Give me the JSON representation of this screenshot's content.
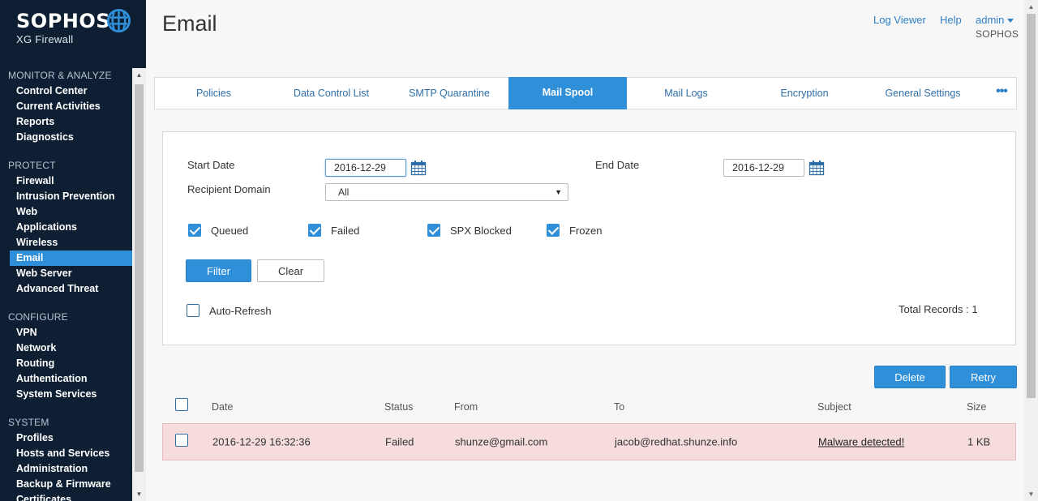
{
  "brand": {
    "name": "SOPHOS",
    "product": "XG Firewall"
  },
  "sidebar": {
    "sections": [
      {
        "title": "MONITOR & ANALYZE",
        "items": [
          "Control Center",
          "Current Activities",
          "Reports",
          "Diagnostics"
        ]
      },
      {
        "title": "PROTECT",
        "items": [
          "Firewall",
          "Intrusion Prevention",
          "Web",
          "Applications",
          "Wireless",
          "Email",
          "Web Server",
          "Advanced Threat"
        ]
      },
      {
        "title": "CONFIGURE",
        "items": [
          "VPN",
          "Network",
          "Routing",
          "Authentication",
          "System Services"
        ]
      },
      {
        "title": "SYSTEM",
        "items": [
          "Profiles",
          "Hosts and Services",
          "Administration",
          "Backup & Firmware",
          "Certificates"
        ]
      }
    ],
    "active_item": "Email"
  },
  "header": {
    "title": "Email",
    "links": {
      "log_viewer": "Log Viewer",
      "help": "Help",
      "user": "admin"
    },
    "org": "SOPHOS"
  },
  "tabs": [
    {
      "label": "Policies"
    },
    {
      "label": "Data Control List"
    },
    {
      "label": "SMTP Quarantine"
    },
    {
      "label": "Mail Spool"
    },
    {
      "label": "Mail Logs"
    },
    {
      "label": "Encryption"
    },
    {
      "label": "General Settings"
    }
  ],
  "tabs_more": "•••",
  "active_tab": "Mail Spool",
  "filter": {
    "start_date_label": "Start Date",
    "start_date": "2016-12-29",
    "end_date_label": "End Date",
    "end_date": "2016-12-29",
    "recipient_domain_label": "Recipient Domain",
    "recipient_domain": "All",
    "checkboxes": [
      {
        "label": "Queued",
        "checked": true
      },
      {
        "label": "Failed",
        "checked": true
      },
      {
        "label": "SPX Blocked",
        "checked": true
      },
      {
        "label": "Frozen",
        "checked": true
      }
    ],
    "filter_button": "Filter",
    "clear_button": "Clear",
    "auto_refresh_label": "Auto-Refresh",
    "total_records": "Total Records : 1"
  },
  "actions": {
    "delete": "Delete",
    "retry": "Retry"
  },
  "table": {
    "columns": [
      "Date",
      "Status",
      "From",
      "To",
      "Subject",
      "Size"
    ],
    "rows": [
      {
        "date": "2016-12-29 16:32:36",
        "status": "Failed",
        "from": "shunze@gmail.com",
        "to": "jacob@redhat.shunze.info",
        "subject": "Malware detected!",
        "size": "1 KB"
      }
    ]
  },
  "colors": {
    "sidebar_bg": "#0e1f33",
    "accent": "#2f8fd8",
    "link": "#2f7fc6",
    "error_row": "#f6dcdc"
  }
}
